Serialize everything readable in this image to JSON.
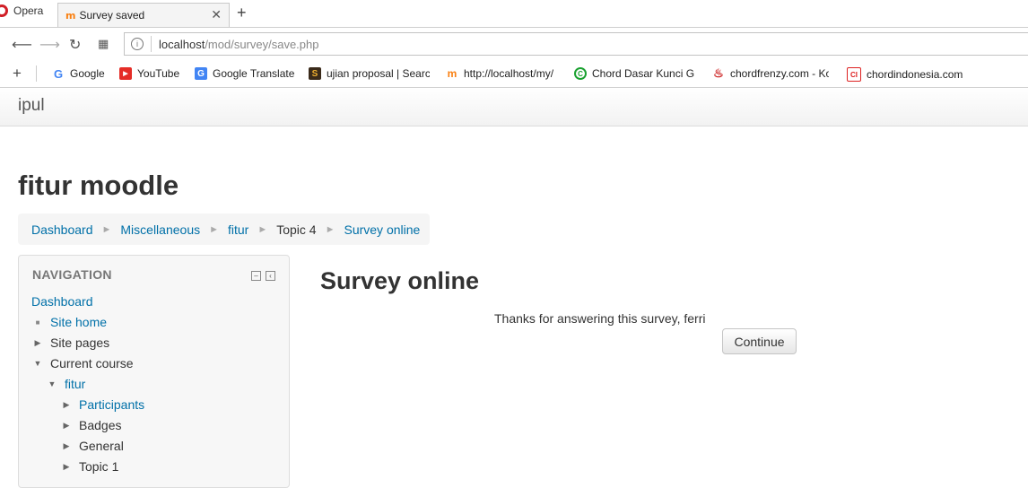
{
  "browser": {
    "opera_label": "Opera",
    "tab_title": "Survey saved",
    "tab_favicon": "m",
    "close_glyph": "✕",
    "new_tab_glyph": "+",
    "url_host": "localhost",
    "url_path": "/mod/survey/save.php",
    "bookmarks": [
      {
        "label": "Google",
        "icon": "google-icon"
      },
      {
        "label": "YouTube",
        "icon": "youtube-icon"
      },
      {
        "label": "Google Translate",
        "icon": "google-translate-icon"
      },
      {
        "label": "ujian proposal | Searc",
        "icon": "scribd-icon"
      },
      {
        "label": "http://localhost/my/",
        "icon": "moodle-icon"
      },
      {
        "label": "Chord Dasar Kunci Gi",
        "icon": "chord-icon"
      },
      {
        "label": "chordfrenzy.com - Ko",
        "icon": "guitar-icon"
      },
      {
        "label": "chordindonesia.com -",
        "icon": "chordindonesia-icon"
      }
    ]
  },
  "site": {
    "brand": "ipul",
    "course_title": "fitur moodle"
  },
  "breadcrumb": {
    "items": [
      "Dashboard",
      "Miscellaneous",
      "fitur",
      "Topic 4",
      "Survey online"
    ],
    "separator": "►"
  },
  "navigation": {
    "heading": "NAVIGATION",
    "items": [
      {
        "label": "Dashboard"
      },
      {
        "label": "Site home"
      },
      {
        "label": "Site pages"
      },
      {
        "label": "Current course"
      },
      {
        "label": "fitur"
      },
      {
        "label": "Participants"
      },
      {
        "label": "Badges"
      },
      {
        "label": "General"
      },
      {
        "label": "Topic 1"
      }
    ]
  },
  "main": {
    "title": "Survey online",
    "message": "Thanks for answering this survey, ferri",
    "continue_label": "Continue"
  },
  "colors": {
    "link": "#0070a8",
    "text": "#333333",
    "breadcrumb_bg": "#f5f5f5",
    "nav_bg": "#f7f7f7"
  }
}
